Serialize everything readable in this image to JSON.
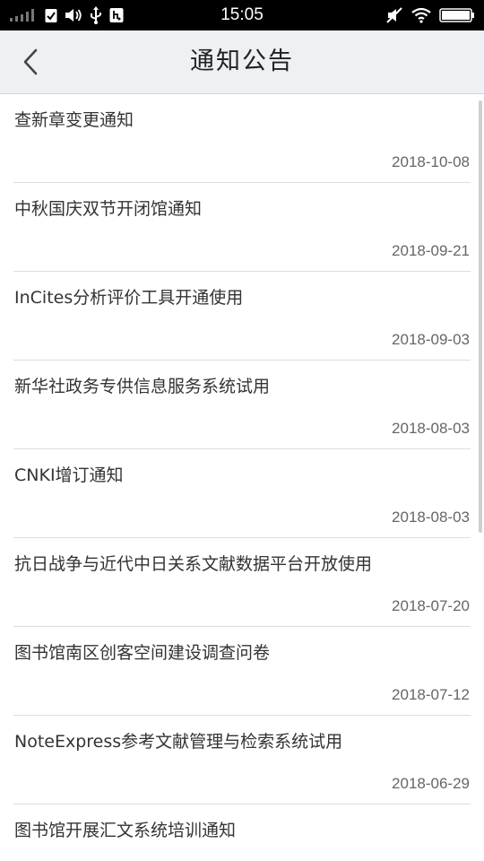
{
  "status_bar": {
    "time": "15:05",
    "icons_left": [
      "signal-icon",
      "check-icon",
      "volume-icon",
      "usb-icon",
      "debug-icon"
    ],
    "icons_right": [
      "mute-icon",
      "wifi-icon",
      "battery-icon"
    ]
  },
  "header": {
    "title": "通知公告",
    "back_icon": "chevron-left-icon"
  },
  "notices": [
    {
      "title": "查新章变更通知",
      "date": "2018-10-08"
    },
    {
      "title": "中秋国庆双节开闭馆通知",
      "date": "2018-09-21"
    },
    {
      "title": "InCites分析评价工具开通使用",
      "date": "2018-09-03"
    },
    {
      "title": "新华社政务专供信息服务系统试用",
      "date": "2018-08-03"
    },
    {
      "title": "CNKI增订通知",
      "date": "2018-08-03"
    },
    {
      "title": "抗日战争与近代中日关系文献数据平台开放使用",
      "date": "2018-07-20"
    },
    {
      "title": "图书馆南区创客空间建设调查问卷",
      "date": "2018-07-12"
    },
    {
      "title": "NoteExpress参考文献管理与检索系统试用",
      "date": "2018-06-29"
    },
    {
      "title": "图书馆开展汇文系统培训通知",
      "date": ""
    }
  ]
}
